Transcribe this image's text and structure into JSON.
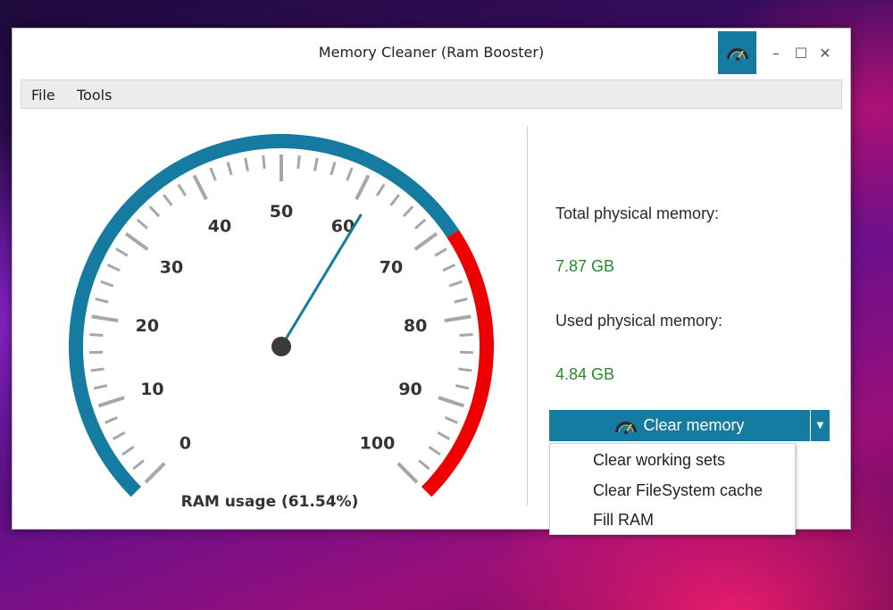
{
  "window": {
    "title": "Memory Cleaner (Ram Booster)",
    "app_icon": "speedometer-icon",
    "controls": {
      "minimize": "–",
      "maximize": "☐",
      "close": "✕"
    }
  },
  "menu": {
    "items": [
      {
        "label": "File"
      },
      {
        "label": "Tools"
      }
    ]
  },
  "gauge": {
    "caption": "RAM usage (61.54%)",
    "value_percent": 61.54,
    "min": 0,
    "max": 100,
    "tick_labels": [
      "0",
      "10",
      "20",
      "30",
      "40",
      "50",
      "60",
      "70",
      "80",
      "90",
      "100"
    ],
    "normal_color": "#157ba0",
    "danger_color": "#ee0000",
    "danger_start": 71
  },
  "info": {
    "total_label": "Total physical memory:",
    "total_value": "7.87 GB",
    "used_label": "Used physical memory:",
    "used_value": "4.84 GB",
    "value_color": "#2a8a2a"
  },
  "clear_button": {
    "label": "Clear memory",
    "icon": "speedometer-icon",
    "arrow_icon": "caret-down-icon",
    "color": "#157ba0"
  },
  "dropdown": {
    "items": [
      {
        "label": "Clear working sets"
      },
      {
        "label": "Clear FileSystem cache"
      },
      {
        "label": "Fill RAM"
      }
    ]
  }
}
